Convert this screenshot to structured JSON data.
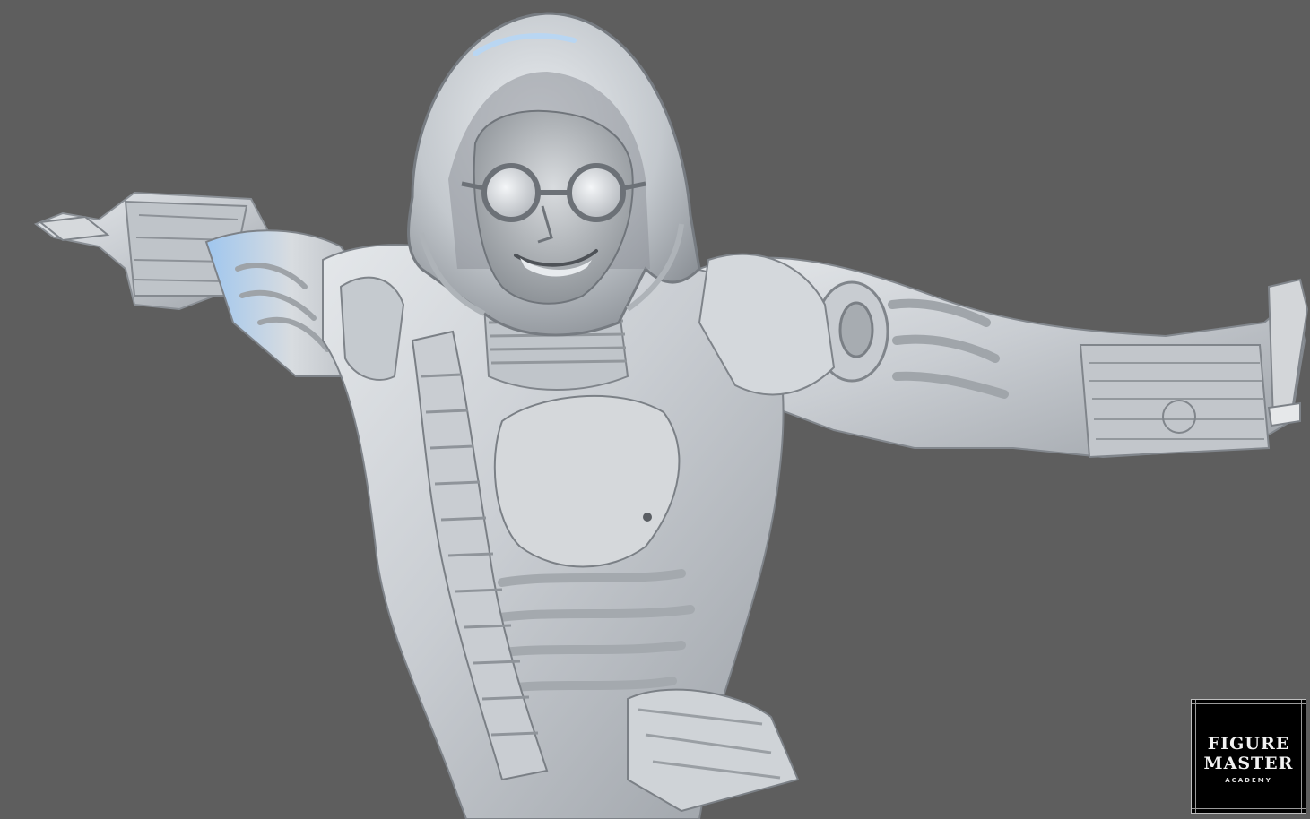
{
  "scene": {
    "background_color": "#5e5e5e",
    "subject": "sculpt-render",
    "material_color": "#cfd3d8",
    "highlight_color": "#a9cdf0",
    "shadow_color": "#7d8288"
  },
  "logo": {
    "line1": "FIGURE",
    "line2": "MASTER",
    "line3": "ACADEMY",
    "background_color": "#000000",
    "text_color": "#f2f2f2"
  }
}
